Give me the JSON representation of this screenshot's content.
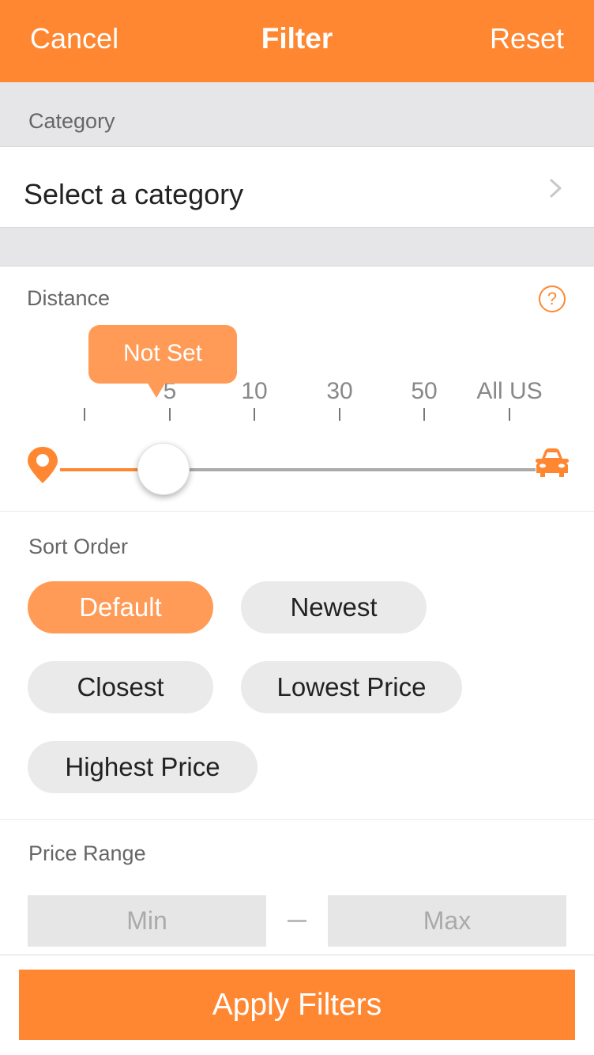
{
  "navbar": {
    "cancel_label": "Cancel",
    "title": "Filter",
    "reset_label": "Reset"
  },
  "category": {
    "header": "Category",
    "select_label": "Select a category",
    "chevron_icon": "chevron-right-icon"
  },
  "distance": {
    "label": "Distance",
    "help_icon_glyph": "?",
    "bubble_text": "Not Set",
    "ticks": [
      "",
      "5",
      "10",
      "30",
      "50",
      "All US"
    ],
    "selected_index": 1,
    "start_icon": "map-pin-icon",
    "end_icon": "car-icon"
  },
  "sort_order": {
    "label": "Sort Order",
    "options": [
      {
        "label": "Default",
        "selected": true
      },
      {
        "label": "Newest",
        "selected": false
      },
      {
        "label": "Closest",
        "selected": false
      },
      {
        "label": "Lowest Price",
        "selected": false
      },
      {
        "label": "Highest Price",
        "selected": false
      }
    ]
  },
  "price_range": {
    "label": "Price Range",
    "min_placeholder": "Min",
    "max_placeholder": "Max",
    "min_value": "",
    "max_value": ""
  },
  "apply_label": "Apply Filters",
  "colors": {
    "accent": "#FF8732",
    "accent_light": "#FF9B57",
    "section_bg": "#E6E6E8"
  }
}
